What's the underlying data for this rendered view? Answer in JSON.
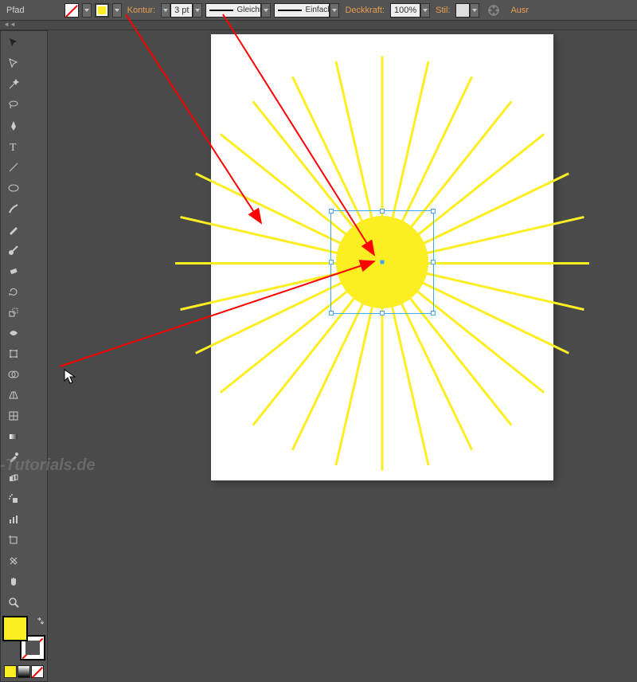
{
  "topbar": {
    "object_type": "Pfad",
    "fill_label": "",
    "stroke_label": "Kontur:",
    "stroke_weight": "3 pt",
    "profile_label": "Gleichm.",
    "brush_label": "Einfach",
    "opacity_label": "Deckkraft:",
    "opacity_value": "100%",
    "style_label": "Stil:",
    "align_label": "Ausr"
  },
  "tools": [
    "selection",
    "direct-selection",
    "magic-wand",
    "lasso",
    "pen",
    "type",
    "line",
    "ellipse",
    "paintbrush",
    "pencil",
    "blob-brush",
    "eraser",
    "rotate",
    "scale",
    "width",
    "free-transform",
    "shape-builder",
    "perspective",
    "mesh",
    "gradient",
    "eyedropper",
    "blend",
    "symbol-sprayer",
    "graph",
    "artboard",
    "slice",
    "hand",
    "zoom"
  ],
  "color": {
    "fill": "#fcee21",
    "stroke": "none"
  },
  "canvas": {
    "rays": 28,
    "selected": true
  },
  "watermark": "-Tutorials.de"
}
